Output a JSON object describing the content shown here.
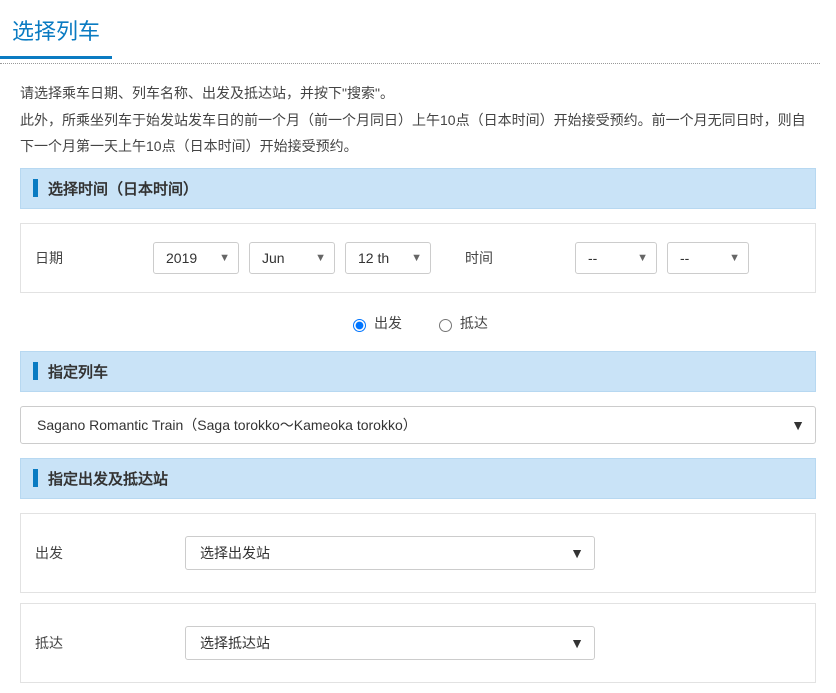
{
  "title": "选择列车",
  "instructions_line1": "请选择乘车日期、列车名称、出发及抵达站，并按下\"搜索\"。",
  "instructions_line2": "此外，所乘坐列车于始发站发车日的前一个月（前一个月同日）上午10点（日本时间）开始接受预约。前一个月无同日时，则自下一个月第一天上午10点（日本时间）开始接受预约。",
  "sections": {
    "time_header": "选择时间（日本时间）",
    "train_header": "指定列车",
    "station_header": "指定出发及抵达站"
  },
  "date": {
    "label": "日期",
    "year": "2019",
    "month": "Jun",
    "day": "12 th"
  },
  "time": {
    "label": "时间",
    "hour": "--",
    "minute": "--"
  },
  "direction": {
    "depart": "出发",
    "arrive": "抵达"
  },
  "train": {
    "selected": "Sagano Romantic Train（Saga torokko～Kameoka torokko）"
  },
  "stations": {
    "depart_label": "出发",
    "depart_value": "选择出发站",
    "arrive_label": "抵达",
    "arrive_value": "选择抵达站"
  }
}
